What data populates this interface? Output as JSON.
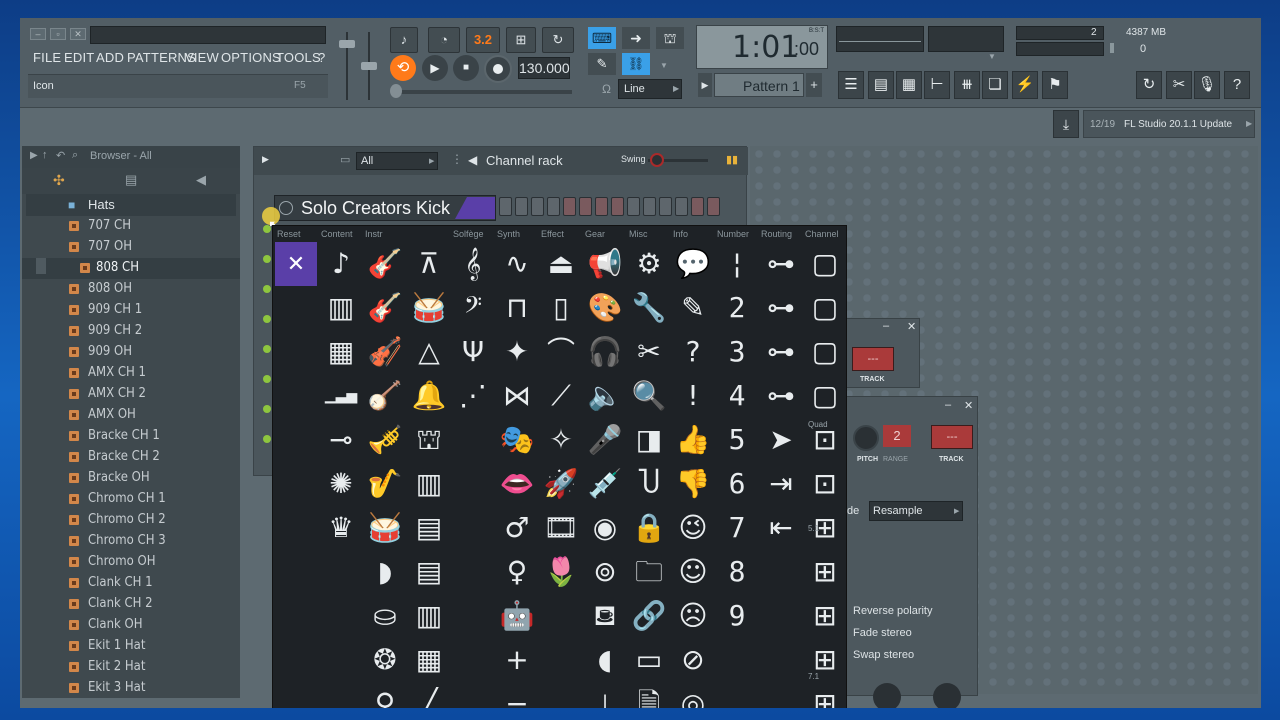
{
  "menu": [
    "FILE",
    "EDIT",
    "ADD",
    "PATTERNS",
    "VIEW",
    "OPTIONS",
    "TOOLS",
    "?"
  ],
  "hint": {
    "label": "Icon",
    "shortcut": "F5"
  },
  "transport": {
    "tempo": "130.000",
    "time": "1:01",
    "time_sub": ":00",
    "time_tag": "B:S:T",
    "snap": "Line",
    "pattern": "Pattern 1"
  },
  "cpu": {
    "value": "2",
    "memory": "4387 MB",
    "mem_sub": "0"
  },
  "update": {
    "count": "12/19",
    "text": "FL Studio 20.1.1 Update"
  },
  "browser": {
    "title": "Browser - All",
    "folder": "Hats",
    "items": [
      "707 CH",
      "707 OH",
      "808 CH",
      "808 OH",
      "909 CH 1",
      "909 CH 2",
      "909 OH",
      "AMX CH 1",
      "AMX CH 2",
      "AMX OH",
      "Bracke CH 1",
      "Bracke CH 2",
      "Bracke OH",
      "Chromo CH 1",
      "Chromo CH 2",
      "Chromo CH 3",
      "Chromo OH",
      "Clank CH 1",
      "Clank CH 2",
      "Clank OH",
      "Ekit 1 Hat",
      "Ekit 2 Hat",
      "Ekit 3 Hat"
    ]
  },
  "rack": {
    "filter": "All",
    "title": "Channel rack",
    "swing": "Swing",
    "channel_name": "Solo Creators Kick"
  },
  "palette": {
    "categories": [
      "Reset",
      "Content",
      "Instr",
      "Solfège",
      "Synth",
      "Effect",
      "Gear",
      "Misc",
      "Info",
      "Number",
      "Routing",
      "Channel"
    ],
    "side_labels": [
      "Quad",
      "5.1",
      "7.1"
    ]
  },
  "side": {
    "track": "TRACK",
    "pitch": "PITCH",
    "range": "RANGE",
    "pitch_value": "2",
    "dash": "---",
    "mode": "de",
    "mode_value": "Resample",
    "options": [
      "Reverse polarity",
      "Fade stereo",
      "Swap stereo"
    ]
  },
  "colors": {
    "accent": "#ff7a1a",
    "background": "#5d6a71",
    "palette": "#1e2226",
    "selected": "#5a3fa8"
  }
}
